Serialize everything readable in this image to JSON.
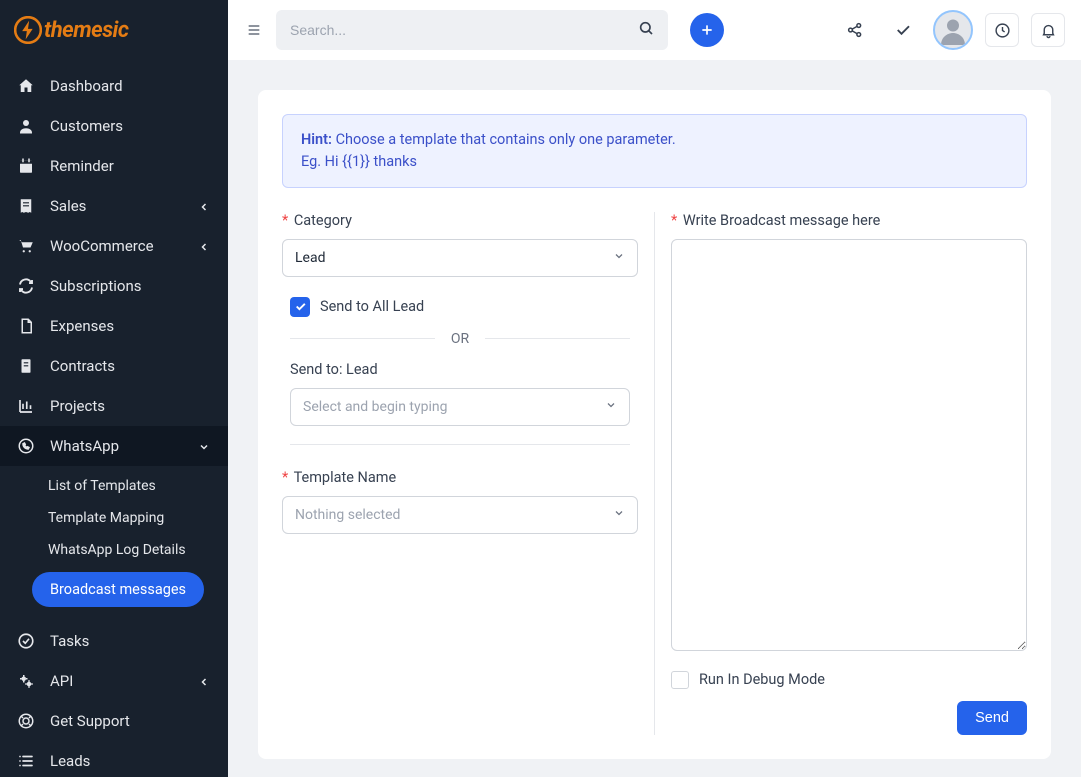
{
  "brand": {
    "name": "themesic"
  },
  "topbar": {
    "search_placeholder": "Search..."
  },
  "sidebar": {
    "items": [
      {
        "id": "dashboard",
        "label": "Dashboard",
        "icon": "home"
      },
      {
        "id": "customers",
        "label": "Customers",
        "icon": "person"
      },
      {
        "id": "reminder",
        "label": "Reminder",
        "icon": "calendar"
      },
      {
        "id": "sales",
        "label": "Sales",
        "icon": "receipt",
        "chevron": true
      },
      {
        "id": "woocommerce",
        "label": "WooCommerce",
        "icon": "cart",
        "chevron": true
      },
      {
        "id": "subscriptions",
        "label": "Subscriptions",
        "icon": "refresh"
      },
      {
        "id": "expenses",
        "label": "Expenses",
        "icon": "file"
      },
      {
        "id": "contracts",
        "label": "Contracts",
        "icon": "doc"
      },
      {
        "id": "projects",
        "label": "Projects",
        "icon": "chart"
      },
      {
        "id": "whatsapp",
        "label": "WhatsApp",
        "icon": "whatsapp",
        "expanded": true,
        "chevron_down": true,
        "sub": [
          {
            "id": "templates",
            "label": "List of Templates"
          },
          {
            "id": "mapping",
            "label": "Template Mapping"
          },
          {
            "id": "log",
            "label": "WhatsApp Log Details"
          },
          {
            "id": "broadcast",
            "label": "Broadcast messages",
            "pill": true
          }
        ]
      },
      {
        "id": "tasks",
        "label": "Tasks",
        "icon": "check-circle"
      },
      {
        "id": "api",
        "label": "API",
        "icon": "gears",
        "chevron": true
      },
      {
        "id": "support",
        "label": "Get Support",
        "icon": "lifebuoy"
      },
      {
        "id": "leads",
        "label": "Leads",
        "icon": "list"
      }
    ]
  },
  "card": {
    "hint_bold": "Hint:",
    "hint_line1": " Choose a template that contains only one parameter.",
    "hint_line2": "Eg. Hi {{1}} thanks",
    "category_label": "Category",
    "category_value": "Lead",
    "send_all_label": "Send to All Lead",
    "or_text": "OR",
    "send_to_label": "Send to: Lead",
    "send_to_placeholder": "Select and begin typing",
    "template_label": "Template Name",
    "template_placeholder": "Nothing selected",
    "broadcast_label": "Write Broadcast message here",
    "debug_label": "Run In Debug Mode",
    "send_button": "Send"
  }
}
